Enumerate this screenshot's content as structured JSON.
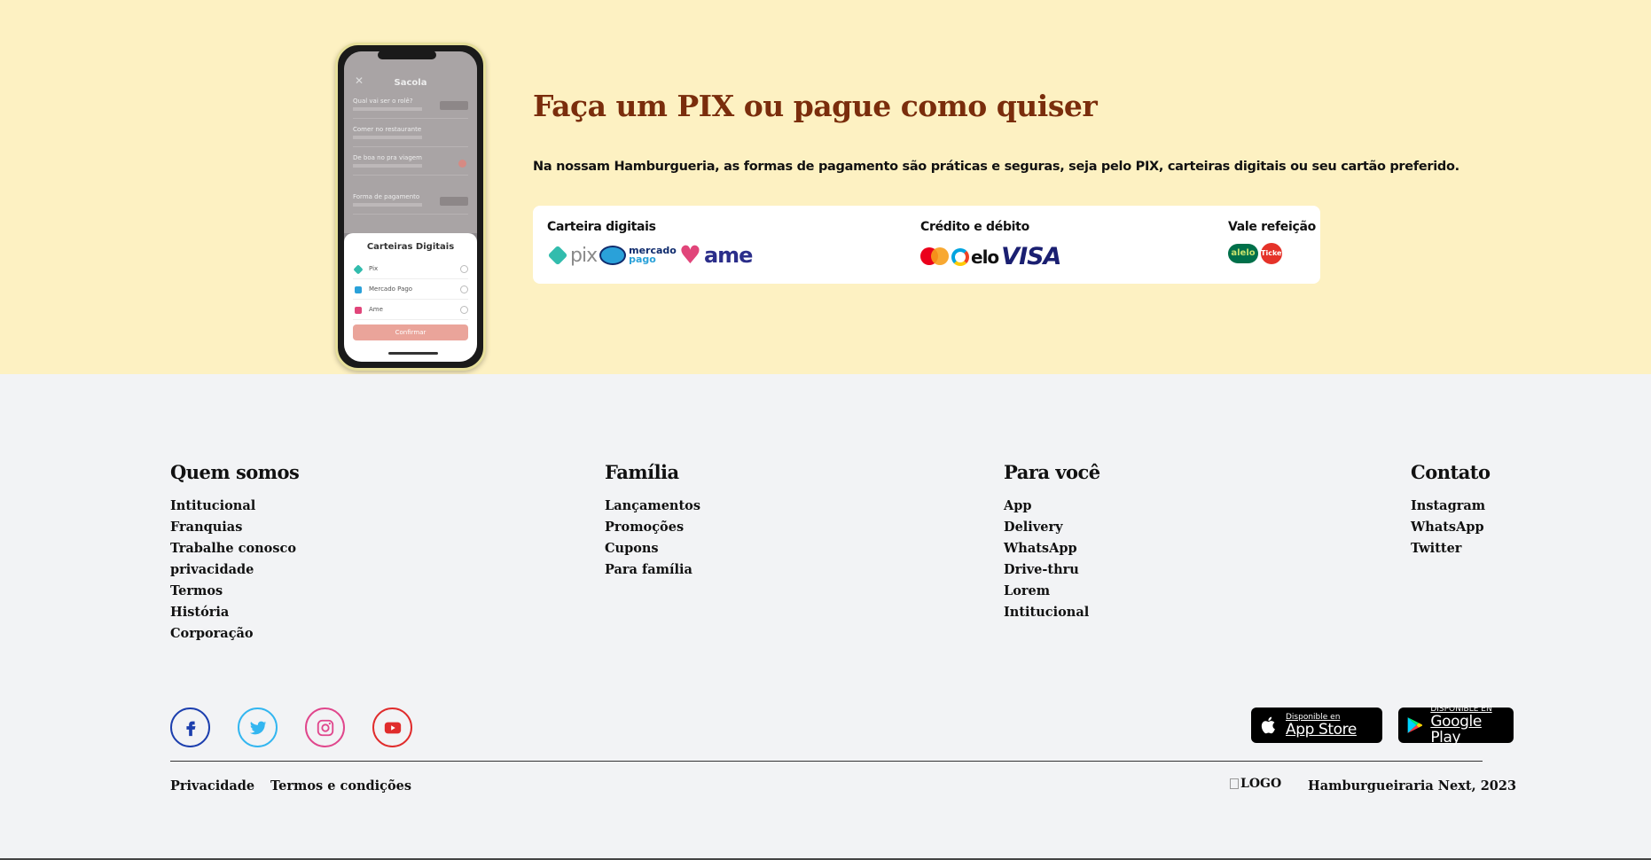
{
  "payment": {
    "title": "Faça um PIX ou pague como quiser",
    "description": "Na nossam Hamburgueria, as formas de pagamento são práticas e seguras, seja pelo PIX, carteiras digitais ou seu cartão preferido.",
    "groups": [
      {
        "label": "Carteira digitais",
        "logos": [
          "pix",
          "Mercado Pago",
          "ame"
        ]
      },
      {
        "label": "Crédito e débito",
        "logos": [
          "mastercard",
          "elo",
          "VISA"
        ]
      },
      {
        "label": "Vale refeição",
        "logos": [
          "alelo",
          "Ticket"
        ]
      }
    ],
    "logo_text": {
      "pix": "pix",
      "mercado": "mercado",
      "pago": "pago",
      "ame": "ame",
      "elo": "elo",
      "visa": "VISA",
      "alelo": "alelo",
      "ticket": "Ticket"
    }
  },
  "phone": {
    "header": "Sacola",
    "rows": [
      "Qual vai ser o rolê?",
      "Comer no restaurante",
      "De boa no pra viagem",
      "Forma de pagamento"
    ],
    "sheet_title": "Carteiras Digitais",
    "options": [
      "Pix",
      "Mercado Pago",
      "Ame"
    ],
    "confirm": "Confirmar"
  },
  "footer": {
    "columns": [
      {
        "title": "Quem somos",
        "links": [
          "Intitucional",
          "Franquias",
          "Trabalhe conosco",
          "privacidade",
          "Termos",
          "História",
          "Corporação"
        ]
      },
      {
        "title": "Família",
        "links": [
          "Lançamentos",
          "Promoções",
          "Cupons",
          "Para família"
        ]
      },
      {
        "title": "Para você",
        "links": [
          "App",
          "Delivery",
          "WhatsApp",
          "Drive-thru",
          "Lorem",
          "Intitucional"
        ]
      },
      {
        "title": "Contato",
        "links": [
          "Instagram",
          "WhatsApp",
          "Twitter"
        ]
      }
    ],
    "social": [
      "facebook-icon",
      "twitter-icon",
      "instagram-icon",
      "youtube-icon"
    ],
    "social_colors": {
      "facebook": "#1c3fae",
      "twitter": "#33b6f0",
      "instagram": "#e0468c",
      "youtube": "#e02c2c"
    },
    "stores": [
      {
        "small": "Disponible en",
        "large": "App Store"
      },
      {
        "small": "DISPONIBLE EN",
        "large": "Google Play"
      }
    ],
    "privacy": "Privacidade",
    "terms": "Termos e condições",
    "logo_alt": "LOGO",
    "copyright": "Hamburgueiraria Next, 2023"
  },
  "colors": {
    "hero_bg": "#fdf1c2",
    "title": "#7a2d0c",
    "footer_bg": "#f2f3f5"
  }
}
